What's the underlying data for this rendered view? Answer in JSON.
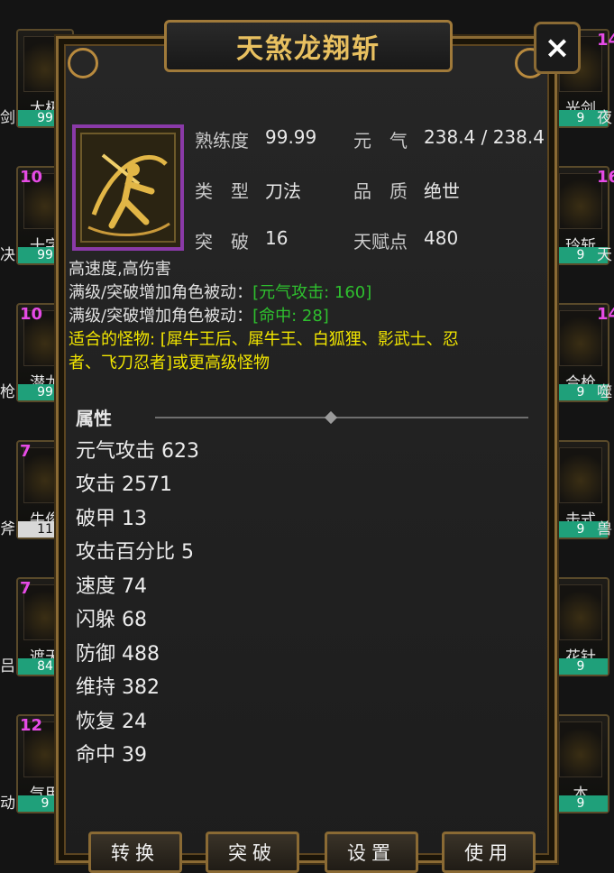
{
  "dialog": {
    "title": "天煞龙翔斩",
    "close_label": "×"
  },
  "info": {
    "proficiency_label": "熟练度",
    "proficiency_value": "99.99",
    "yuanqi_label": "元　气",
    "yuanqi_value": "238.4 / 238.4",
    "type_label": "类　型",
    "type_value": "刀法",
    "quality_label": "品　质",
    "quality_value": "绝世",
    "breakthrough_label": "突　破",
    "breakthrough_value": "16",
    "talent_label": "天赋点",
    "talent_value": "480"
  },
  "description": {
    "line1": "高速度,高伤害",
    "passive1_label": "满级/突破增加角色被动：",
    "passive1_value": "[元气攻击: 160]",
    "passive2_label": "满级/突破增加角色被动：",
    "passive2_value": "[命中: 28]",
    "monsters_line1": "适合的怪物: [犀牛王后、犀牛王、白狐狸、影武士、忍",
    "monsters_line2": "者、飞刀忍者]或更高级怪物"
  },
  "attributes": {
    "header": "属性",
    "items": [
      {
        "text": "元气攻击  623"
      },
      {
        "text": "攻击  2571"
      },
      {
        "text": "破甲  13"
      },
      {
        "text": "攻击百分比  5"
      },
      {
        "text": "速度  74"
      },
      {
        "text": "闪躲  68"
      },
      {
        "text": "防御  488"
      },
      {
        "text": "维持  382"
      },
      {
        "text": "恢复  24"
      },
      {
        "text": "命中  39"
      }
    ]
  },
  "buttons": {
    "convert": "转换",
    "breakthrough": "突破",
    "settings": "设置",
    "use": "使用"
  },
  "background_tiles": {
    "left": [
      {
        "level": "",
        "name": "太极",
        "bar": "99",
        "label_left": "剑"
      },
      {
        "level": "10",
        "name": "十字",
        "bar": "99",
        "label_left": "决"
      },
      {
        "level": "10",
        "name": "潜龙",
        "bar": "99",
        "label_left": "枪"
      },
      {
        "level": "7",
        "name": "牛俊",
        "bar": "11",
        "label_left": "斧"
      },
      {
        "level": "7",
        "name": "遮天",
        "bar": "84",
        "label_left": "吕"
      },
      {
        "level": "12",
        "name": "气甲",
        "bar": "9",
        "label_left": "动"
      }
    ],
    "right": [
      {
        "level": "14",
        "name": "光剑",
        "name2": "夜",
        "bar": "9"
      },
      {
        "level": "16",
        "name": "玲斩",
        "name2": "天",
        "bar": "9"
      },
      {
        "level": "14",
        "name": "合枪",
        "name2": "噬",
        "bar": "9"
      },
      {
        "level": "",
        "name": "击式",
        "name2": "兽",
        "bar": "9"
      },
      {
        "level": "",
        "name": "花针",
        "name2": "",
        "bar": "9"
      },
      {
        "level": "",
        "name": "本",
        "name2": "",
        "bar": "9"
      }
    ]
  },
  "colors": {
    "title_gold": "#e8c060",
    "frame_gold": "#8a6a34",
    "green_text": "#2ec02e",
    "yellow_text": "#f2e600",
    "rarity_purple": "#8a3aa8",
    "level_magenta": "#e64be6",
    "bar_green": "#1fa07a"
  }
}
